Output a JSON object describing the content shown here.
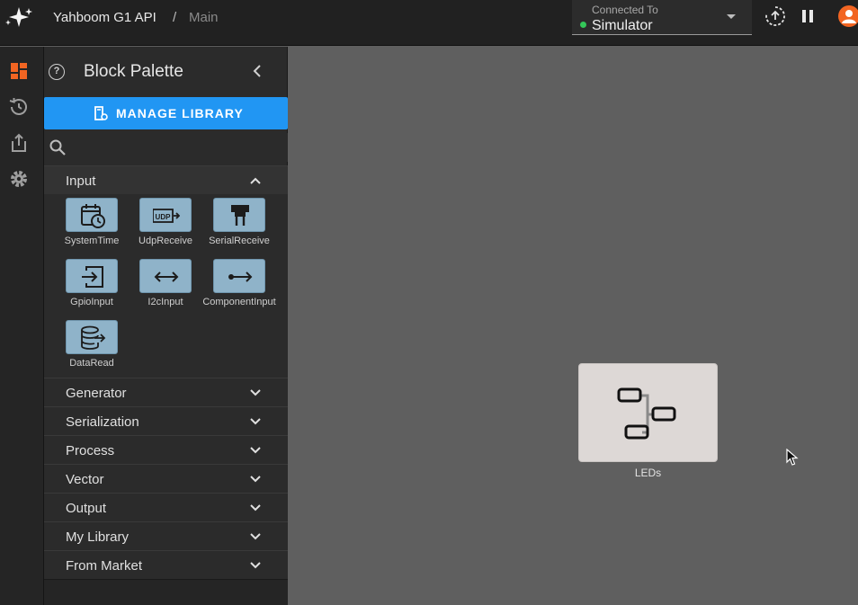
{
  "header": {
    "project": "Yahboom G1 API",
    "separator": "/",
    "page": "Main",
    "connection": {
      "label": "Connected To",
      "value": "Simulator",
      "status_color": "#34c759"
    },
    "icons": [
      "logo-icon",
      "deploy-icon",
      "pause-icon",
      "user-avatar-icon"
    ]
  },
  "rail": {
    "icons": [
      "dashboard-icon",
      "history-icon",
      "export-icon",
      "settings-icon"
    ],
    "active_color": "#f26522"
  },
  "palette": {
    "title": "Block Palette",
    "manage_button": "MANAGE LIBRARY",
    "search": {
      "value": "",
      "placeholder": ""
    },
    "sections": [
      {
        "label": "Input",
        "expanded": true
      },
      {
        "label": "Generator",
        "expanded": false
      },
      {
        "label": "Serialization",
        "expanded": false
      },
      {
        "label": "Process",
        "expanded": false
      },
      {
        "label": "Vector",
        "expanded": false
      },
      {
        "label": "Output",
        "expanded": false
      },
      {
        "label": "My Library",
        "expanded": false
      },
      {
        "label": "From Market",
        "expanded": false
      }
    ],
    "input_blocks": [
      {
        "label": "SystemTime",
        "icon": "calendar-clock-icon"
      },
      {
        "label": "UdpReceive",
        "icon": "udp-icon"
      },
      {
        "label": "SerialReceive",
        "icon": "serial-plug-icon"
      },
      {
        "label": "GpioInput",
        "icon": "gpio-input-icon"
      },
      {
        "label": "I2cInput",
        "icon": "bidirectional-arrow-icon"
      },
      {
        "label": "ComponentInput",
        "icon": "connector-arrow-icon"
      },
      {
        "label": "DataRead",
        "icon": "database-read-icon"
      }
    ],
    "udp_text": "UDP"
  },
  "canvas": {
    "node": {
      "label": "LEDs",
      "icon": "component-graph-icon"
    }
  },
  "colors": {
    "accent": "#2196f3",
    "brand": "#f26522",
    "block_tile": "#8fb3c9"
  }
}
